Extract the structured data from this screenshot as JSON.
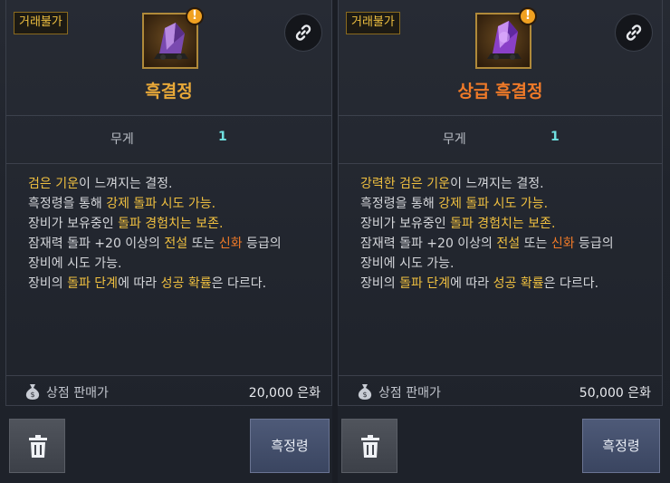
{
  "panels": [
    {
      "trade_badge": "거래불가",
      "item_name": "흑결정",
      "weight_label": "무게",
      "weight_value": "1",
      "description_lines": [
        [
          {
            "t": "검은 기운",
            "c": "y"
          },
          {
            "t": "이 느껴지는 결정.",
            "c": ""
          }
        ],
        [
          {
            "t": "흑정령을 통해 ",
            "c": ""
          },
          {
            "t": "강제 돌파 시도 가능.",
            "c": "y"
          }
        ],
        [
          {
            "t": "장비가 보유중인 ",
            "c": ""
          },
          {
            "t": "돌파 경험치는 보존.",
            "c": "y"
          }
        ],
        [
          {
            "t": "잠재력 돌파 +20 이상의 ",
            "c": ""
          },
          {
            "t": "전설",
            "c": "y"
          },
          {
            "t": " 또는 ",
            "c": ""
          },
          {
            "t": "신화",
            "c": "o"
          },
          {
            "t": " 등급의",
            "c": ""
          }
        ],
        [
          {
            "t": "장비에 시도 가능.",
            "c": ""
          }
        ],
        [
          {
            "t": "장비의 ",
            "c": ""
          },
          {
            "t": "돌파 단계",
            "c": "y"
          },
          {
            "t": "에 따라 ",
            "c": ""
          },
          {
            "t": "성공 확률",
            "c": "y"
          },
          {
            "t": "은 다르다.",
            "c": ""
          }
        ]
      ],
      "price_label": "상점 판매가",
      "price_value": "20,000 은화",
      "action_label": "흑정령",
      "crystal_color": "#8a5ac0"
    },
    {
      "trade_badge": "거래불가",
      "item_name": "상급 흑결정",
      "weight_label": "무게",
      "weight_value": "1",
      "description_lines": [
        [
          {
            "t": "강력한 검은 기운",
            "c": "y"
          },
          {
            "t": "이 느껴지는 결정.",
            "c": ""
          }
        ],
        [
          {
            "t": "흑정령을 통해 ",
            "c": ""
          },
          {
            "t": "강제 돌파 시도 가능.",
            "c": "y"
          }
        ],
        [
          {
            "t": "장비가 보유중인 ",
            "c": ""
          },
          {
            "t": "돌파 경험치는 보존.",
            "c": "y"
          }
        ],
        [
          {
            "t": "잠재력 돌파 +20 이상의 ",
            "c": ""
          },
          {
            "t": "전설",
            "c": "y"
          },
          {
            "t": " 또는 ",
            "c": ""
          },
          {
            "t": "신화",
            "c": "o"
          },
          {
            "t": " 등급의",
            "c": ""
          }
        ],
        [
          {
            "t": "장비에 시도 가능.",
            "c": ""
          }
        ],
        [
          {
            "t": "장비의 ",
            "c": ""
          },
          {
            "t": "돌파 단계",
            "c": "y"
          },
          {
            "t": "에 따라 ",
            "c": ""
          },
          {
            "t": "성공 확률",
            "c": "y"
          },
          {
            "t": "은 다르다.",
            "c": ""
          }
        ]
      ],
      "price_label": "상점 판매가",
      "price_value": "50,000 은화",
      "action_label": "흑정령",
      "crystal_color": "#9a50d8"
    }
  ],
  "colors": {
    "highlight_yellow": "#f0c040",
    "highlight_orange": "#f07a28",
    "weight_value": "#6fe0e0"
  },
  "icons": {
    "alert": "alert-icon",
    "link": "link-icon",
    "trash": "trash-icon",
    "money_bag": "money-bag-icon"
  }
}
